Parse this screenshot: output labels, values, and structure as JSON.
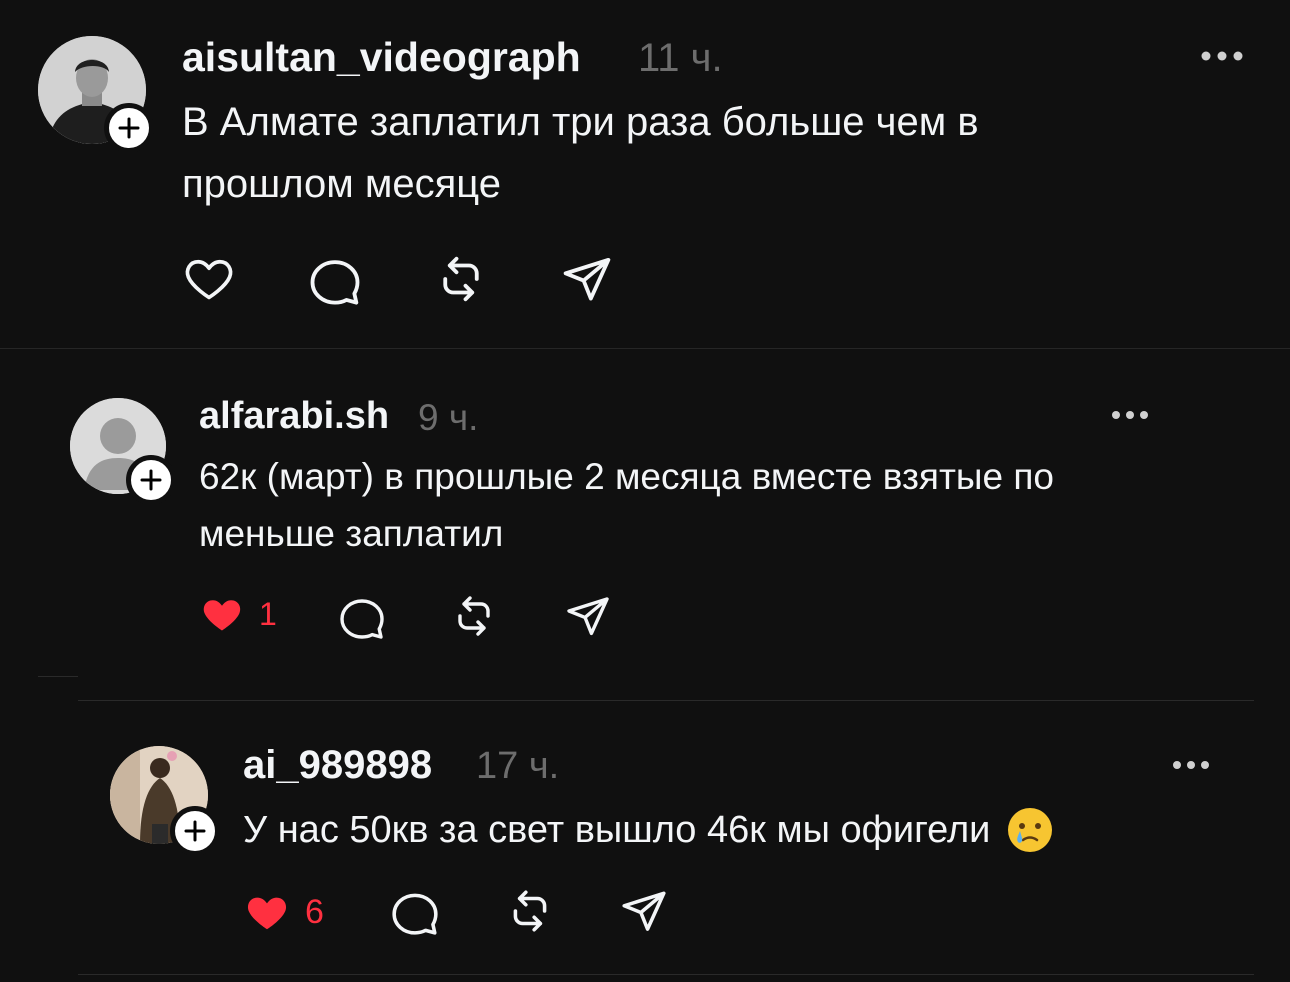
{
  "colors": {
    "background": "#101010",
    "text": "#f3f5f7",
    "muted": "#6d6d6d",
    "like": "#ff3040"
  },
  "posts": [
    {
      "username": "aisultan_videograph",
      "time": "11 ч.",
      "text_lines": [
        "В Алмате заплатил три раза больше чем в",
        "прошлом месяце"
      ],
      "liked": false,
      "like_count": ""
    },
    {
      "username": "alfarabi.sh",
      "time": "9 ч.",
      "text_lines": [
        "62к (март) в прошлые 2 месяца вместе взятые по",
        "меньше заплатил"
      ],
      "liked": true,
      "like_count": "1"
    },
    {
      "username": "ai_989898",
      "time": "17 ч.",
      "text_lines": [
        "У нас 50кв за свет вышло 46к мы офигели"
      ],
      "emoji": "crying-face",
      "liked": true,
      "like_count": "6"
    }
  ]
}
